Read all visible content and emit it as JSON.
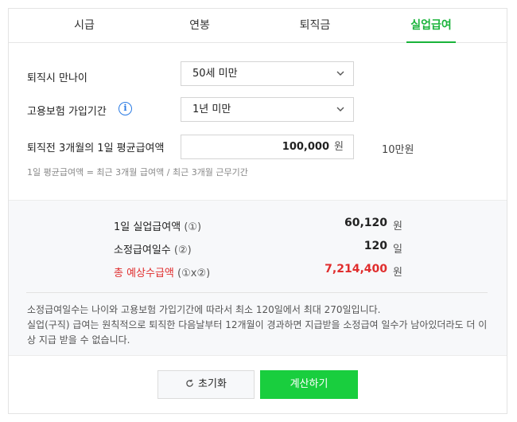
{
  "tabs": [
    {
      "label": "시급"
    },
    {
      "label": "연봉"
    },
    {
      "label": "퇴직금"
    },
    {
      "label": "실업급여",
      "active": true
    }
  ],
  "form": {
    "age_label": "퇴직시 만나이",
    "age_value": "50세 미만",
    "period_label": "고용보험 가입기간",
    "period_info_icon": "i",
    "period_value": "1년 미만",
    "wage_label": "퇴직전 3개월의 1일 평균급여액",
    "wage_value": "100,000",
    "wage_unit": "원",
    "wage_hint": "10만원",
    "formula_text": "1일 평균급여액 = 최근 3개월 급여액 / 최근 3개월 근무기간"
  },
  "results": {
    "daily_label": "1일 실업급여액",
    "daily_mark": "(①)",
    "daily_value": "60,120",
    "daily_unit": "원",
    "days_label": "소정급여일수",
    "days_mark": "(②)",
    "days_value": "120",
    "days_unit": "일",
    "total_label": "총 예상수급액",
    "total_mark": "(①x②)",
    "total_value": "7,214,400",
    "total_unit": "원",
    "note_line1": "소정급여일수는 나이와 고용보험 가입기간에 따라서 최소 120일에서 최대 270일입니다.",
    "note_line2": "실업(구직) 급여는 원칙적으로 퇴직한 다음날부터 12개월이 경과하면 지급받을 소정급여 일수가 남아있더라도 더 이상 지급 받을 수 없습니다."
  },
  "buttons": {
    "reset_label": "초기화",
    "calc_label": "계산하기"
  },
  "colors": {
    "accent_green": "#19ce3e",
    "tab_green": "#19b33a",
    "total_red": "#e02d2d",
    "info_blue": "#2b7be4"
  }
}
